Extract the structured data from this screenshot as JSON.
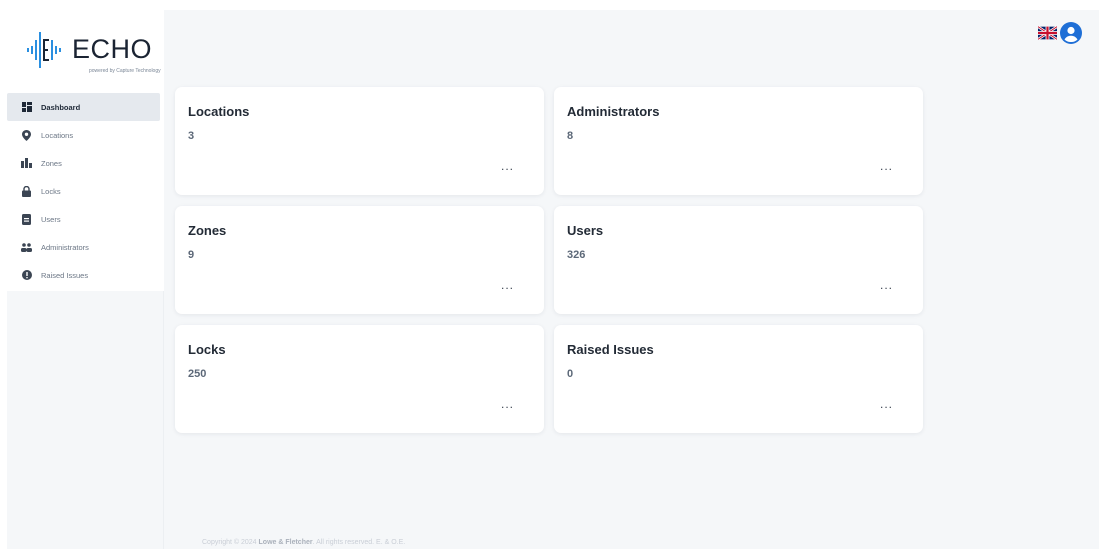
{
  "brand": {
    "name": "ECHO",
    "tagline": "powered by Capture Technology"
  },
  "sidebar": {
    "items": [
      {
        "label": "Dashboard",
        "icon": "dashboard-icon",
        "active": true
      },
      {
        "label": "Locations",
        "icon": "map-pin-icon"
      },
      {
        "label": "Zones",
        "icon": "building-icon"
      },
      {
        "label": "Locks",
        "icon": "lock-icon"
      },
      {
        "label": "Users",
        "icon": "id-card-icon"
      },
      {
        "label": "Administrators",
        "icon": "users-icon"
      },
      {
        "label": "Raised Issues",
        "icon": "alert-circle-icon"
      }
    ]
  },
  "header": {
    "language_icon": "uk-flag-icon",
    "profile_icon": "user-circle-icon"
  },
  "cards": [
    {
      "title": "Locations",
      "value": "3",
      "menu": "..."
    },
    {
      "title": "Administrators",
      "value": "8",
      "menu": "..."
    },
    {
      "title": "Zones",
      "value": "9",
      "menu": "..."
    },
    {
      "title": "Users",
      "value": "326",
      "menu": "..."
    },
    {
      "title": "Locks",
      "value": "250",
      "menu": "..."
    },
    {
      "title": "Raised Issues",
      "value": "0",
      "menu": "..."
    }
  ],
  "footer": {
    "prefix": "Copyright © 2024 ",
    "company": "Lowe & Fletcher",
    "suffix": ". All rights reserved. E. & O.E."
  },
  "colors": {
    "accent": "#1f6fd6",
    "background": "#f5f7f9",
    "card": "#ffffff",
    "text": "#232b36"
  }
}
